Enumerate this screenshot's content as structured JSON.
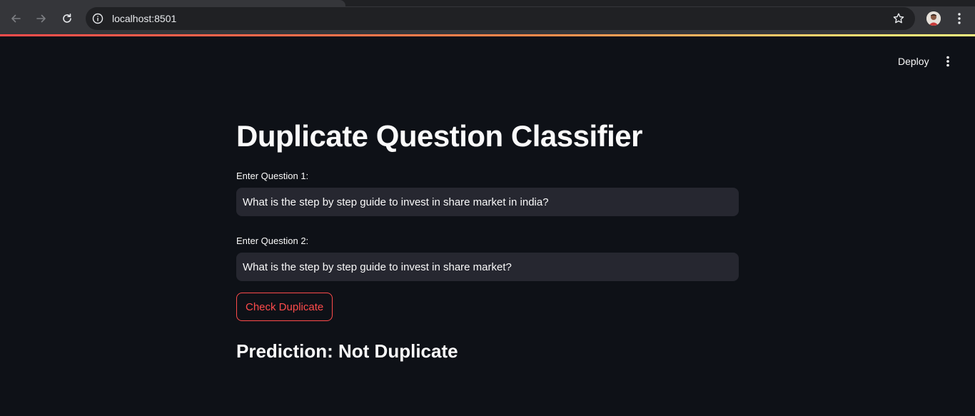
{
  "browser": {
    "url": "localhost:8501",
    "icons": [
      "back-arrow-icon",
      "forward-arrow-icon",
      "reload-icon",
      "site-info-icon",
      "bookmark-star-icon",
      "profile-avatar",
      "chrome-menu-icon"
    ]
  },
  "header": {
    "deploy_label": "Deploy",
    "menu_icon": "kebab-menu-icon"
  },
  "main": {
    "title": "Duplicate Question Classifier",
    "question1": {
      "label": "Enter Question 1:",
      "value": "What is the step by step guide to invest in share market in india?"
    },
    "question2": {
      "label": "Enter Question 2:",
      "value": "What is the step by step guide to invest in share market?"
    },
    "check_button_label": "Check Duplicate",
    "prediction": "Prediction: Not Duplicate"
  },
  "colors": {
    "background": "#0e1117",
    "input_background": "#262730",
    "accent": "#ff4b4b",
    "text": "#fafafa",
    "browser_chrome": "#35363a"
  }
}
